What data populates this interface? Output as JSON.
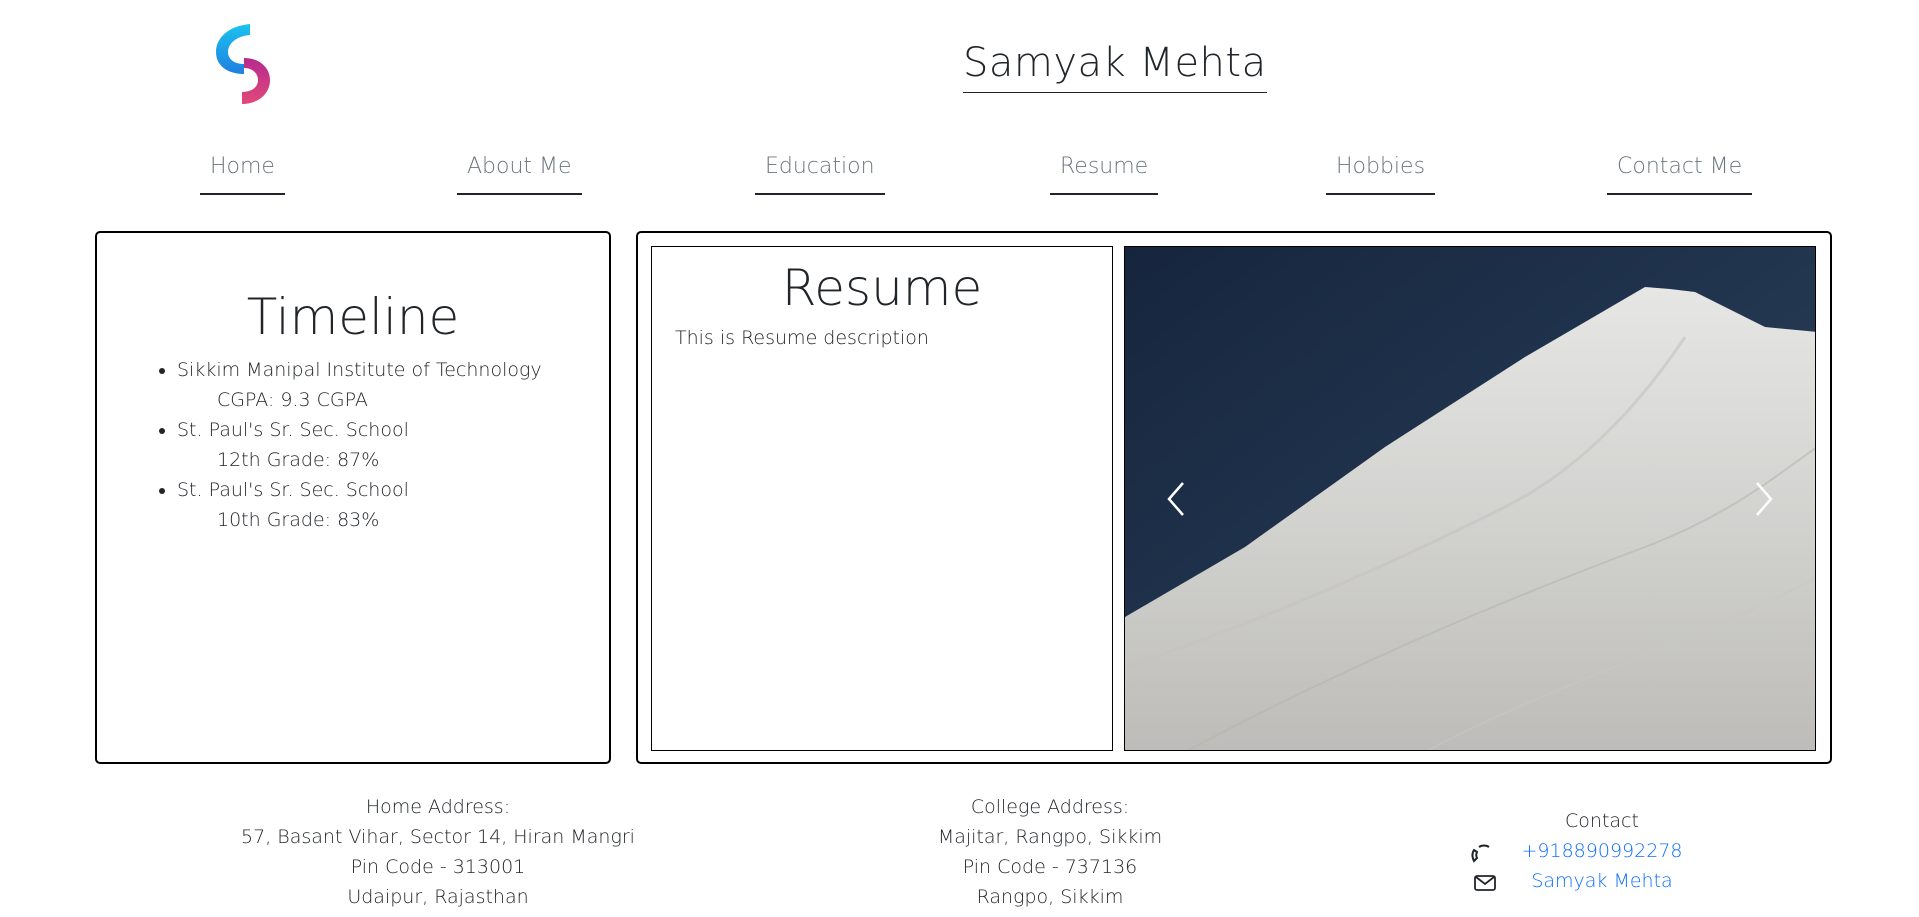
{
  "header": {
    "title": "Samyak Mehta",
    "logo_icon": "logo-icon"
  },
  "nav": {
    "items": [
      {
        "label": "Home"
      },
      {
        "label": "About Me"
      },
      {
        "label": "Education"
      },
      {
        "label": "Resume"
      },
      {
        "label": "Hobbies"
      },
      {
        "label": "Contact Me"
      }
    ]
  },
  "timeline": {
    "title": "Timeline",
    "entries": [
      {
        "institution": "Sikkim Manipal Institute of Technology",
        "detail": "CGPA: 9.3 CGPA"
      },
      {
        "institution": "St. Paul's Sr. Sec. School",
        "detail": "12th Grade: 87%"
      },
      {
        "institution": "St. Paul's Sr. Sec. School",
        "detail": "10th Grade: 83%"
      }
    ]
  },
  "resume": {
    "title": "Resume",
    "description": "This is Resume description"
  },
  "carousel": {
    "prev_icon": "chevron-left-icon",
    "next_icon": "chevron-right-icon"
  },
  "footer": {
    "home_address": {
      "heading": "Home Address:",
      "lines": [
        "57, Basant Vihar, Sector 14, Hiran Mangri",
        "Pin Code - 313001",
        "Udaipur, Rajasthan"
      ]
    },
    "college_address": {
      "heading": "College Address:",
      "lines": [
        "Majitar, Rangpo, Sikkim",
        "Pin Code - 737136",
        "Rangpo, Sikkim"
      ]
    },
    "contact": {
      "heading": "Contact",
      "phone": "+918890992278",
      "phone_icon": "phone-icon",
      "email_label": "Samyak Mehta",
      "email_icon": "envelope-icon"
    }
  },
  "colors": {
    "link": "#0d6efd",
    "nav_text": "#6c757d",
    "text": "#212529",
    "logo_blue": "#0aa6e8",
    "logo_pink": "#d63384"
  }
}
